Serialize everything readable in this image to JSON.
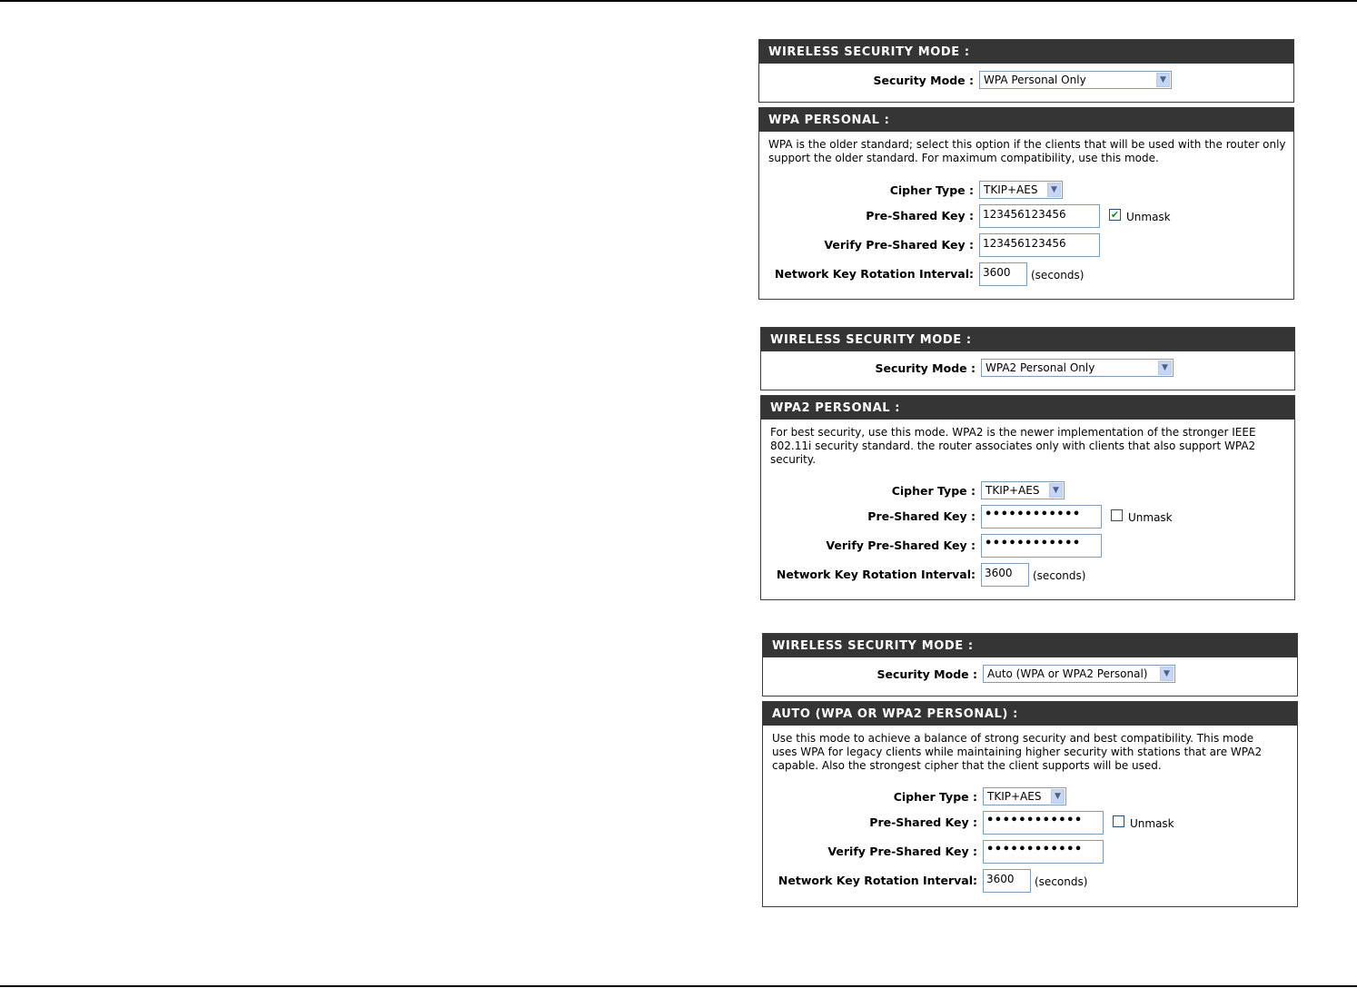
{
  "sections": [
    {
      "mode_header": "WIRELESS SECURITY MODE :",
      "security_mode_label": "Security Mode :",
      "security_mode_value": "WPA Personal Only",
      "detail_header": "WPA PERSONAL :",
      "description": "WPA is the older standard; select this option if the clients that will be used with the router only support the older standard. For maximum compatibility, use this mode.",
      "cipher_label": "Cipher Type :",
      "cipher_value": "TKIP+AES",
      "psk_label": "Pre-Shared Key :",
      "psk_value": "123456123456",
      "unmask_checked": true,
      "unmask_label": "Unmask",
      "verify_label": "Verify Pre-Shared Key :",
      "verify_value": "123456123456",
      "rotation_label": "Network Key Rotation Interval:",
      "rotation_value": "3600",
      "rotation_unit": "(seconds)"
    },
    {
      "mode_header": "WIRELESS SECURITY MODE :",
      "security_mode_label": "Security Mode :",
      "security_mode_value": "WPA2 Personal Only",
      "detail_header": "WPA2 PERSONAL :",
      "description": "For best security, use this mode. WPA2 is the newer implementation of the stronger IEEE 802.11i security standard. the router associates only with clients that also support WPA2 security.",
      "cipher_label": "Cipher Type :",
      "cipher_value": "TKIP+AES",
      "psk_label": "Pre-Shared Key :",
      "psk_value": "••••••••••••",
      "unmask_checked": false,
      "unmask_label": "Unmask",
      "verify_label": "Verify Pre-Shared Key :",
      "verify_value": "••••••••••••",
      "rotation_label": "Network Key Rotation Interval:",
      "rotation_value": "3600",
      "rotation_unit": "(seconds)"
    },
    {
      "mode_header": "WIRELESS SECURITY MODE :",
      "security_mode_label": "Security Mode :",
      "security_mode_value": "Auto (WPA or WPA2 Personal)",
      "detail_header": "AUTO (WPA OR WPA2 PERSONAL) :",
      "description": "Use this mode to achieve a balance of strong security and best compatibility. This mode uses WPA for legacy clients while maintaining higher security with stations that are WPA2 capable. Also the strongest cipher that the client supports will be used.",
      "cipher_label": "Cipher Type :",
      "cipher_value": "TKIP+AES",
      "psk_label": "Pre-Shared Key :",
      "psk_value": "••••••••••••",
      "unmask_checked": false,
      "unmask_label": "Unmask",
      "verify_label": "Verify Pre-Shared Key :",
      "verify_value": "••••••••••••",
      "rotation_label": "Network Key Rotation Interval:",
      "rotation_value": "3600",
      "rotation_unit": "(seconds)"
    }
  ]
}
